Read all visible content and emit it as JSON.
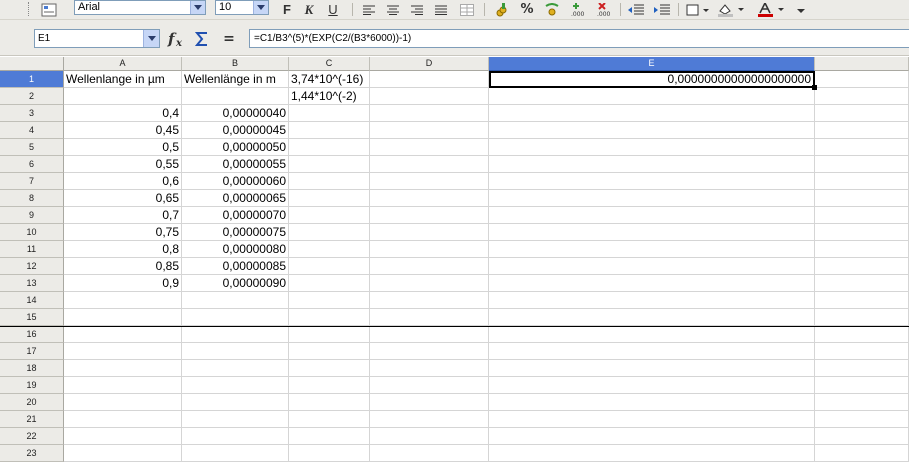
{
  "toolbar": {
    "font_name": "Arial",
    "font_size": "10",
    "bold_label": "F",
    "italic_label": "K",
    "underline_label": "U",
    "percent_label": "%"
  },
  "formula_bar": {
    "cell_ref": "E1",
    "formula": "=C1/B3^(5)*(EXP(C2/(B3*6000))-1)",
    "equals_label": "="
  },
  "columns": [
    {
      "label": "A"
    },
    {
      "label": "B"
    },
    {
      "label": "C"
    },
    {
      "label": "D"
    },
    {
      "label": "E"
    }
  ],
  "selected_column": "E",
  "selected_row": "1",
  "rows": [
    {
      "num": "1",
      "A": "Wellenlange in µm",
      "B": "Wellenlänge in m",
      "C": "3,74*10^(-16)",
      "D": "",
      "E": "0,00000000000000000000"
    },
    {
      "num": "2",
      "A": "",
      "B": "",
      "C": "1,44*10^(-2)",
      "D": "",
      "E": ""
    },
    {
      "num": "3",
      "A": "0,4",
      "B": "0,00000040",
      "C": "",
      "D": "",
      "E": ""
    },
    {
      "num": "4",
      "A": "0,45",
      "B": "0,00000045",
      "C": "",
      "D": "",
      "E": ""
    },
    {
      "num": "5",
      "A": "0,5",
      "B": "0,00000050",
      "C": "",
      "D": "",
      "E": ""
    },
    {
      "num": "6",
      "A": "0,55",
      "B": "0,00000055",
      "C": "",
      "D": "",
      "E": ""
    },
    {
      "num": "7",
      "A": "0,6",
      "B": "0,00000060",
      "C": "",
      "D": "",
      "E": ""
    },
    {
      "num": "8",
      "A": "0,65",
      "B": "0,00000065",
      "C": "",
      "D": "",
      "E": ""
    },
    {
      "num": "9",
      "A": "0,7",
      "B": "0,00000070",
      "C": "",
      "D": "",
      "E": ""
    },
    {
      "num": "10",
      "A": "0,75",
      "B": "0,00000075",
      "C": "",
      "D": "",
      "E": ""
    },
    {
      "num": "11",
      "A": "0,8",
      "B": "0,00000080",
      "C": "",
      "D": "",
      "E": ""
    },
    {
      "num": "12",
      "A": "0,85",
      "B": "0,00000085",
      "C": "",
      "D": "",
      "E": ""
    },
    {
      "num": "13",
      "A": "0,9",
      "B": "0,00000090",
      "C": "",
      "D": "",
      "E": ""
    },
    {
      "num": "14",
      "A": "",
      "B": "",
      "C": "",
      "D": "",
      "E": ""
    },
    {
      "num": "15",
      "A": "",
      "B": "",
      "C": "",
      "D": "",
      "E": ""
    },
    {
      "num": "16",
      "A": "",
      "B": "",
      "C": "",
      "D": "",
      "E": ""
    },
    {
      "num": "17",
      "A": "",
      "B": "",
      "C": "",
      "D": "",
      "E": ""
    },
    {
      "num": "18",
      "A": "",
      "B": "",
      "C": "",
      "D": "",
      "E": ""
    },
    {
      "num": "19",
      "A": "",
      "B": "",
      "C": "",
      "D": "",
      "E": ""
    },
    {
      "num": "20",
      "A": "",
      "B": "",
      "C": "",
      "D": "",
      "E": ""
    },
    {
      "num": "21",
      "A": "",
      "B": "",
      "C": "",
      "D": "",
      "E": ""
    },
    {
      "num": "22",
      "A": "",
      "B": "",
      "C": "",
      "D": "",
      "E": ""
    },
    {
      "num": "23",
      "A": "",
      "B": "",
      "C": "",
      "D": "",
      "E": ""
    }
  ],
  "icons": {
    "styles": "styles-icon",
    "currency": "currency-icon",
    "add_decimal": "add-decimal-icon",
    "delete_decimal": "delete-decimal-icon"
  },
  "colors": {
    "selection": "#4f7bd6",
    "chrome": "#ecebe7"
  }
}
